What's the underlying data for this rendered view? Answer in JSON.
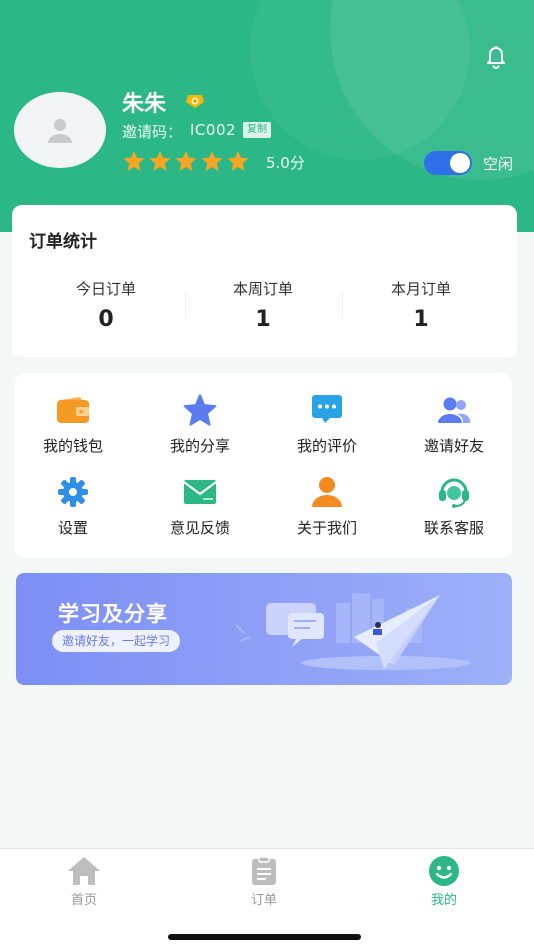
{
  "header": {
    "username": "朱朱",
    "invite_label": "邀请码：",
    "invite_code": "IC002",
    "copy_label": "复制",
    "rating_stars": 5,
    "score": "5.0分",
    "status_label": "空闲",
    "status_on": true
  },
  "orders": {
    "title": "订单统计",
    "stats": [
      {
        "label": "今日订单",
        "value": "0"
      },
      {
        "label": "本周订单",
        "value": "1"
      },
      {
        "label": "本月订单",
        "value": "1"
      }
    ]
  },
  "menu": {
    "items": [
      {
        "label": "我的钱包",
        "icon": "wallet-icon"
      },
      {
        "label": "我的分享",
        "icon": "star-icon"
      },
      {
        "label": "我的评价",
        "icon": "comment-icon"
      },
      {
        "label": "邀请好友",
        "icon": "friends-icon"
      },
      {
        "label": "设置",
        "icon": "settings-icon"
      },
      {
        "label": "意见反馈",
        "icon": "mail-icon"
      },
      {
        "label": "关于我们",
        "icon": "person-icon"
      },
      {
        "label": "联系客服",
        "icon": "headset-icon"
      }
    ]
  },
  "banner": {
    "title": "学习及分享",
    "subtitle": "邀请好友，一起学习"
  },
  "tabbar": {
    "tabs": [
      {
        "label": "首页",
        "icon": "home-icon",
        "active": false
      },
      {
        "label": "订单",
        "icon": "clipboard-icon",
        "active": false
      },
      {
        "label": "我的",
        "icon": "smile-icon",
        "active": true
      }
    ]
  },
  "colors": {
    "brand_green": "#2bb786",
    "toggle_blue": "#2f6fe8",
    "star_orange": "#f5a623",
    "banner_blue": "#8fa0f7"
  }
}
